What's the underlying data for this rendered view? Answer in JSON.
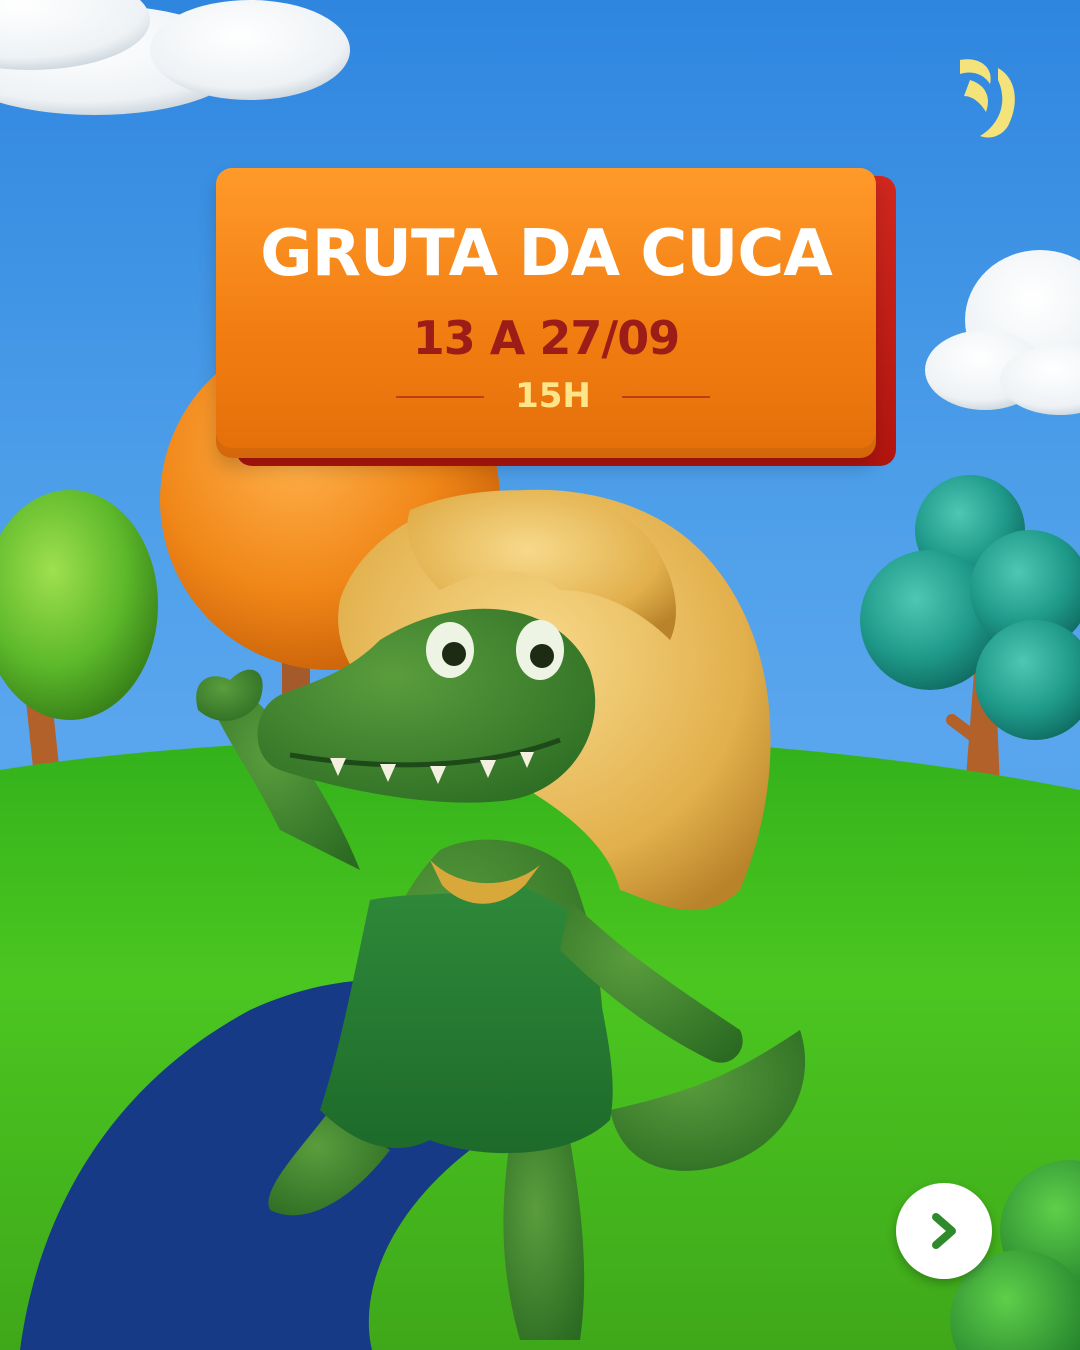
{
  "post": {
    "title": "GRUTA DA CUCA",
    "dates": "13 A 27/09",
    "time": "15H"
  },
  "icons": {
    "logo": "leaf-flame-logo-icon",
    "next": "chevron-right-icon"
  },
  "colors": {
    "sky": "#3d8ee0",
    "grass": "#45c11f",
    "path": "#163a86",
    "banner": "#f27e12",
    "banner_shadow": "#c41d17",
    "title_text": "#ffffff",
    "dates_text": "#9c1c18",
    "time_text": "#ffe58a",
    "logo": "#f4e27a"
  },
  "scene": {
    "character": "green alligator with blonde hair in green dress, waving",
    "elements": [
      "clouds",
      "orange tree",
      "green tree",
      "teal tree",
      "blue path",
      "grass hill"
    ]
  }
}
